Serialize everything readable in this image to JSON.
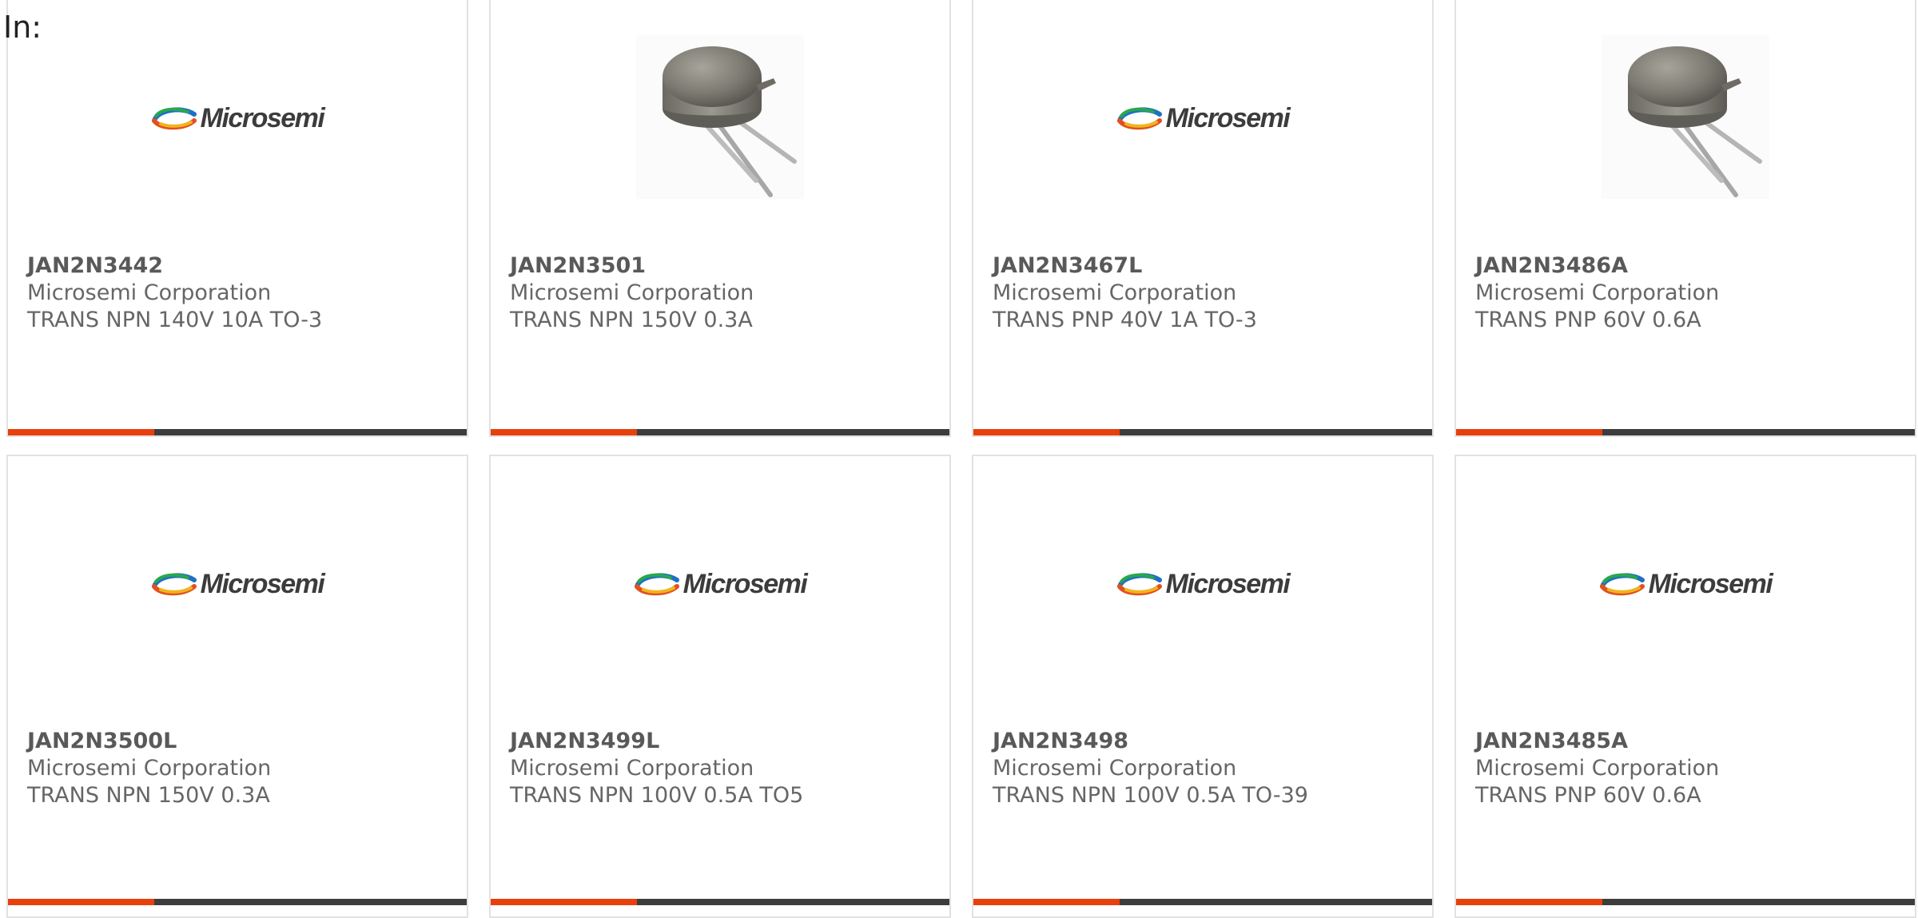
{
  "prefix_label": "In:",
  "accent_color": "#e8400c",
  "bar_color": "#3d3d3d",
  "logo_text": "Microsemi",
  "products": [
    {
      "part": "JAN2N3442",
      "manufacturer": "Microsemi Corporation",
      "description": "TRANS NPN 140V 10A TO-3",
      "image": "microsemi-logo"
    },
    {
      "part": "JAN2N3501",
      "manufacturer": "Microsemi Corporation",
      "description": "TRANS NPN 150V 0.3A",
      "image": "to-can-transistor"
    },
    {
      "part": "JAN2N3467L",
      "manufacturer": "Microsemi Corporation",
      "description": "TRANS PNP 40V 1A TO-3",
      "image": "microsemi-logo"
    },
    {
      "part": "JAN2N3486A",
      "manufacturer": "Microsemi Corporation",
      "description": "TRANS PNP 60V 0.6A",
      "image": "to-can-transistor"
    },
    {
      "part": "JAN2N3500L",
      "manufacturer": "Microsemi Corporation",
      "description": "TRANS NPN 150V 0.3A",
      "image": "microsemi-logo"
    },
    {
      "part": "JAN2N3499L",
      "manufacturer": "Microsemi Corporation",
      "description": "TRANS NPN 100V 0.5A TO5",
      "image": "microsemi-logo"
    },
    {
      "part": "JAN2N3498",
      "manufacturer": "Microsemi Corporation",
      "description": "TRANS NPN 100V 0.5A TO-39",
      "image": "microsemi-logo"
    },
    {
      "part": "JAN2N3485A",
      "manufacturer": "Microsemi Corporation",
      "description": "TRANS PNP 60V 0.6A",
      "image": "microsemi-logo"
    }
  ]
}
